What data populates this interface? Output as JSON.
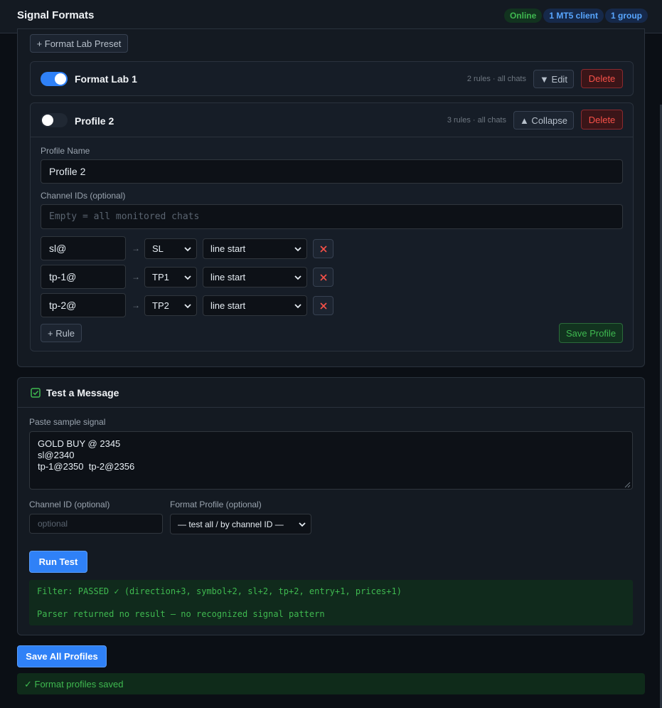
{
  "header": {
    "title": "Signal Formats",
    "badges": [
      "Online",
      "1 MT5 client",
      "1 group"
    ]
  },
  "formats_panel": {
    "preset_button": "+ Format Lab Preset",
    "profiles": [
      {
        "name": "Format Lab 1",
        "enabled": true,
        "meta": "2 rules · all chats",
        "expand_button": "▼ Edit",
        "delete_button": "Delete"
      },
      {
        "name": "Profile 2",
        "enabled": false,
        "meta": "3 rules · all chats",
        "expand_button": "▲ Collapse",
        "delete_button": "Delete",
        "editor": {
          "profile_name_label": "Profile Name",
          "profile_name_value": "Profile 2",
          "channel_ids_label": "Channel IDs (optional)",
          "channel_ids_placeholder": "Empty = all monitored chats",
          "rules": [
            {
              "token": "sl@",
              "arrow": "→",
              "field": "SL",
              "position": "line start"
            },
            {
              "token": "tp-1@",
              "arrow": "→",
              "field": "TP1",
              "position": "line start"
            },
            {
              "token": "tp-2@",
              "arrow": "→",
              "field": "TP2",
              "position": "line start"
            }
          ],
          "add_rule_button": "+ Rule",
          "save_profile_button": "Save Profile"
        }
      }
    ]
  },
  "test_panel": {
    "title": "Test a Message",
    "sample_label": "Paste sample signal",
    "sample_value": "GOLD BUY @ 2345\nsl@2340\ntp-1@2350  tp-2@2356",
    "channel_id_label": "Channel ID (optional)",
    "channel_id_placeholder": "optional",
    "format_profile_label": "Format Profile (optional)",
    "format_profile_value": "— test all / by channel ID —",
    "run_button": "Run Test",
    "results": [
      "Filter: PASSED ✓ (direction+3, symbol+2, sl+2, tp+2, entry+1, prices+1)",
      "Parser returned no result — no recognized signal pattern"
    ]
  },
  "footer": {
    "save_all_button": "Save All Profiles",
    "saved_message": "✓ Format profiles saved"
  },
  "colors": {
    "accent": "#2f81f7",
    "success": "#3fb950",
    "danger": "#f85149",
    "background": "#0b0f15"
  }
}
